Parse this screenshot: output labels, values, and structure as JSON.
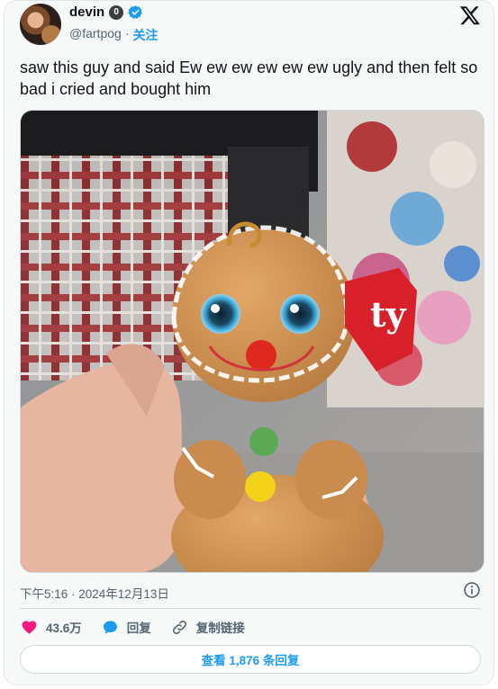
{
  "author": {
    "display_name": "devin",
    "badge_glyph": "0",
    "handle": "@fartpog",
    "separator": "·",
    "follow_label": "关注"
  },
  "tweet": {
    "text": "saw this guy and said Ew ew ew ew ew ew ugly and then felt so bad i cried and bought him",
    "timestamp": "下午5:16 · 2024年12月13日"
  },
  "actions": {
    "likes_count": "43.6万",
    "reply_label": "回复",
    "copy_link_label": "复制链接"
  },
  "replies_button_label": "查看 1,876 条回复",
  "icons": {
    "verified": "verified-badge-icon",
    "x_logo": "x-logo-icon",
    "info": "info-icon",
    "like": "heart-icon",
    "reply": "speech-bubble-icon",
    "copy_link": "link-icon"
  },
  "colors": {
    "accent": "#1d9bf0",
    "like": "#f91880",
    "muted_text": "#536471",
    "card_bg": "#f7f9f9"
  }
}
